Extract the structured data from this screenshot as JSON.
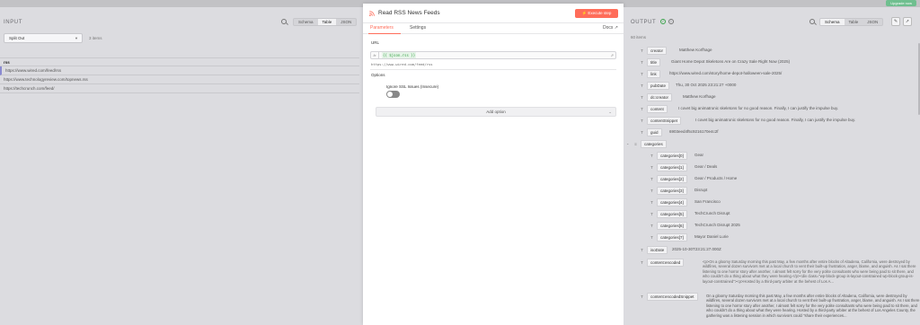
{
  "top": {
    "crumb": "",
    "upgrade_label": "Upgrade now"
  },
  "input": {
    "title": "INPUT",
    "views": [
      "Schema",
      "Table",
      "JSON"
    ],
    "active_view": "Table",
    "node_select": "Split Out",
    "items_count": "3 items",
    "table": {
      "column": "rss",
      "rows": [
        "https://www.wired.com/feed/rss",
        "https://www.technologyreview.com/topnews.rss",
        "https://techcrunch.com/feed/"
      ]
    }
  },
  "modal": {
    "title": "Read RSS News Feeds",
    "execute_label": "Execute step",
    "tabs": [
      "Parameters",
      "Settings"
    ],
    "docs_label": "Docs",
    "url_label": "URL",
    "url_expression": "{{ $json.rss }}",
    "url_preview": "https://www.wired.com/feed/rss",
    "options_label": "Options",
    "ssl_label": "Ignore SSL Issues (Insecure)",
    "ssl_on": false,
    "add_option_label": "Add option"
  },
  "output": {
    "title": "OUTPUT",
    "views": [
      "Schema",
      "Table",
      "JSON"
    ],
    "active_view": "Schema",
    "items_count": "60 items",
    "fields": [
      {
        "key": "creator",
        "value": "Matthew Korfhage"
      },
      {
        "key": "title",
        "value": "Giant Home Depot Skeletons Are on Crazy Sale Right Now (2025)"
      },
      {
        "key": "link",
        "value": "https://www.wired.com/story/home-depot-halloween-sale-2025/"
      },
      {
        "key": "pubDate",
        "value": "Thu, 30 Oct 2025 23:21:27 +0000"
      },
      {
        "key": "dc:creator",
        "value": "Matthew Korfhage"
      },
      {
        "key": "content",
        "value": "I covet big animatronic skeletons for no good reason. Finally, I can justify the impulse buy."
      },
      {
        "key": "contentSnippet",
        "value": "I covet big animatronic skeletons for no good reason. Finally, I can justify the impulse buy."
      },
      {
        "key": "guid",
        "value": "6903eed4f5c9216170e4c2f"
      }
    ],
    "categories_key": "categories",
    "categories": [
      {
        "key": "categories[0]",
        "value": "Gear"
      },
      {
        "key": "categories[1]",
        "value": "Gear / Deals"
      },
      {
        "key": "categories[2]",
        "value": "Gear / Products / Home"
      },
      {
        "key": "categories[3]",
        "value": "Disrupt"
      },
      {
        "key": "categories[4]",
        "value": "San Francisco"
      },
      {
        "key": "categories[5]",
        "value": "TechCrunch Disrupt"
      },
      {
        "key": "categories[6]",
        "value": "TechCrunch Disrupt 2025"
      },
      {
        "key": "categories[7]",
        "value": "Mayor Daniel Lurie"
      }
    ],
    "isoDate": {
      "key": "isoDate",
      "value": "2025-10-30T23:21:27.000Z"
    },
    "encoded": {
      "key": "content:encoded",
      "value": "<p>On a gloomy Saturday morning this past May, a few months after entire blocks of Altadena, California, were destroyed by wildfires, several dozen survivors met at a local church to vent their built-up frustration, anger, blame, and anguish. As I sat there listening to one horror story after another, I almost felt sorry for the very polite consultants who were being paid to sit there, and who couldn't do a thing about what they were hearing.</p><div class=\"wp-block-group is-layout-constrained wp-block-group-is-layout-constrained\"><p>Hosted by a third-party arbiter at the behest of Los A..."
    },
    "encodedSnippet": {
      "key": "content:encodedSnippet",
      "value": "On a gloomy Saturday morning this past May, a few months after entire blocks of Altadena, California, were destroyed by wildfires, several dozen survivors met at a local church to vent their built-up frustration, anger, blame, and anguish. As I sat there listening to one horror story after another, I almost felt sorry for the very polite consultants who were being paid to sit there, and who couldn't do a thing about what they were hearing. Hosted by a third-party arbiter at the behest of Los Angeles County, the gathering was a listening session in which survivors could \"share their experiences..."
    }
  },
  "colors": {
    "accent": "#ff6d5a",
    "success": "#3aa34a",
    "upgrade": "#6fbf8f"
  }
}
